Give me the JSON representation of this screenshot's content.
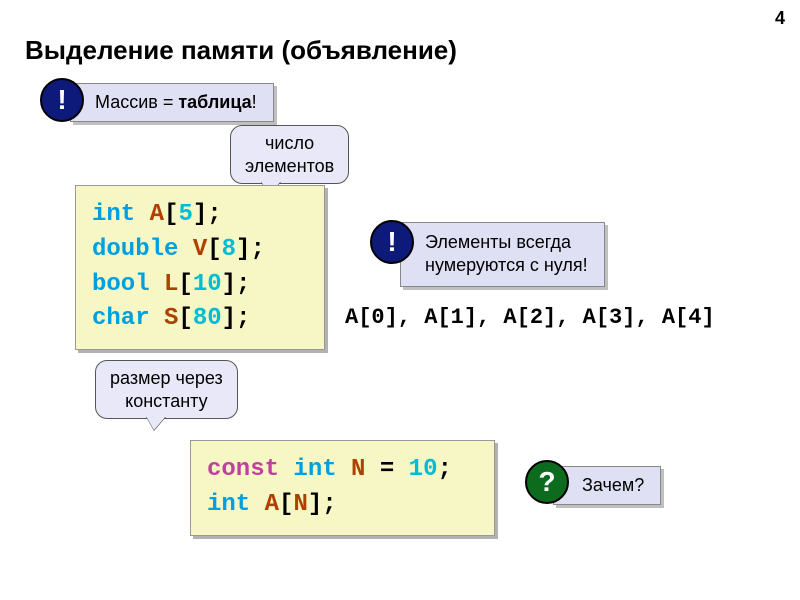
{
  "page_number": "4",
  "title": "Выделение памяти (объявление)",
  "badges": {
    "bang": "!",
    "question": "?"
  },
  "callouts": {
    "array_is_table_pre": "Массив = ",
    "array_is_table_bold": "таблица",
    "array_is_table_post": "!",
    "element_count": "число\nэлементов",
    "zero_index": "Элементы всегда\nнумеруются с нуля!",
    "size_via_const": "размер через\nконстанту",
    "why": "Зачем?"
  },
  "code1": {
    "l1": {
      "t": "int",
      "sp": " ",
      "id": "A",
      "br": "[",
      "n": "5",
      "cl": "];"
    },
    "l2": {
      "t": "double",
      "sp": " ",
      "id": "V",
      "br": "[",
      "n": "8",
      "cl": "];"
    },
    "l3": {
      "t": "bool",
      "sp": " ",
      "id": "L",
      "br": "[",
      "n": "10",
      "cl": "];"
    },
    "l4": {
      "t": "char",
      "sp": " ",
      "id": "S",
      "br": "[",
      "n": "80",
      "cl": "];"
    }
  },
  "indices_line": "A[0], A[1], A[2], A[3], A[4]",
  "code2": {
    "l1": {
      "kw": "const",
      "sp1": " ",
      "t": "int",
      "sp2": " ",
      "id": "N",
      "eq": " = ",
      "n": "10",
      "sc": ";"
    },
    "l2": {
      "t": "int",
      "sp": " ",
      "id": "A",
      "br": "[",
      "ref": "N",
      "cl": "];"
    }
  }
}
